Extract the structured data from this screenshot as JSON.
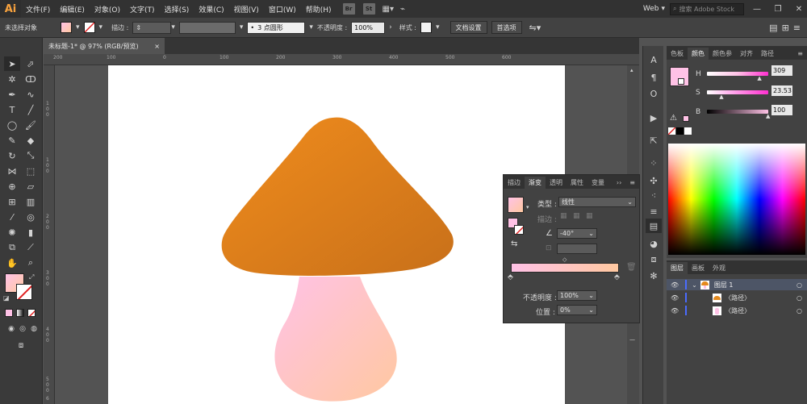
{
  "app": {
    "logo": "Ai"
  },
  "menu": [
    "文件(F)",
    "编辑(E)",
    "对象(O)",
    "文字(T)",
    "选择(S)",
    "效果(C)",
    "视图(V)",
    "窗口(W)",
    "帮助(H)"
  ],
  "menu_chips": {
    "br": "Br",
    "st": "St"
  },
  "workspace": {
    "label": "Web",
    "search_placeholder": "搜索 Adobe Stock"
  },
  "control": {
    "no_selection": "未选择对象",
    "stroke_label": "描边 :",
    "point_value": "3 点圆形",
    "opacity_label": "不透明度 :",
    "opacity_value": "100%",
    "style_label": "样式 :",
    "doc_setup": "文档设置",
    "preferences": "首选项"
  },
  "document_tab": {
    "title": "未标题-1* @ 97% (RGB/预览)",
    "close": "×"
  },
  "ruler_top": [
    "200",
    "100",
    "0",
    "100",
    "200",
    "300",
    "400",
    "500",
    "600"
  ],
  "ruler_left": [
    "1",
    "0",
    "0",
    "1",
    "0",
    "0",
    "2",
    "0",
    "0",
    "3",
    "0",
    "0",
    "4",
    "0",
    "0",
    "5",
    "0",
    "0",
    "6"
  ],
  "color_panel": {
    "tabs": [
      "色板",
      "颜色",
      "颜色参",
      "对齐",
      "路径"
    ],
    "active_tab": 1,
    "h_label": "H",
    "h_value": "309",
    "s_label": "S",
    "s_value": "23.53",
    "b_label": "B",
    "b_value": "100",
    "h_fraction": 0.86,
    "s_fraction": 0.24,
    "b_fraction": 1.0
  },
  "layers_panel": {
    "tabs": [
      "图层",
      "画板",
      "外观"
    ],
    "active_tab": 0,
    "layer_name": "图层 1",
    "items": [
      "〈路径〉",
      "〈路径〉"
    ]
  },
  "gradient_panel": {
    "tabs": [
      "描边",
      "渐变",
      "透明",
      "属性",
      "变量"
    ],
    "active_tab": 1,
    "type_label": "类型 :",
    "type_value": "线性",
    "stroke_label": "描边 :",
    "angle_value": "-40°",
    "opacity_label": "不透明度 :",
    "opacity_value": "100%",
    "position_label": "位置 :",
    "position_value": "0%"
  },
  "colors": {
    "cap_start": "#f08c1c",
    "cap_end": "#c8701a",
    "stem_start": "#ffc2e6",
    "stem_end": "#ffc8a0",
    "accent_orange": "#f7a23e"
  }
}
